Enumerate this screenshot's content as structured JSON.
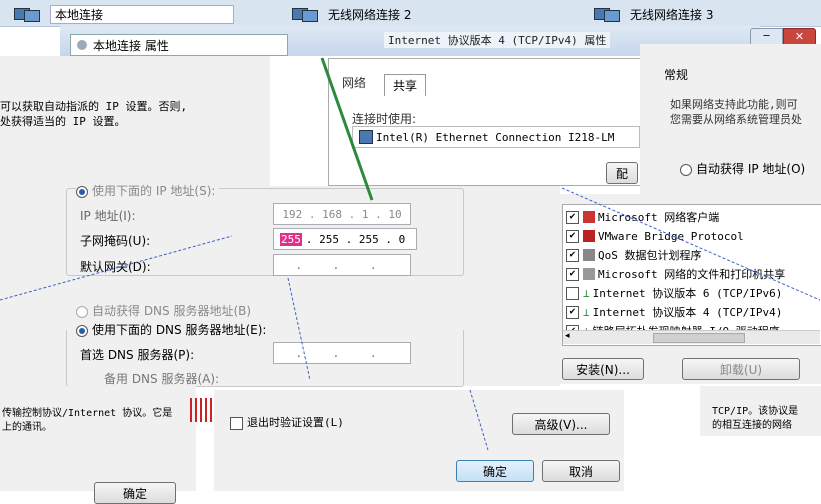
{
  "top_strip": {
    "items": [
      "本地连接",
      "无线网络连接 2",
      "无线网络连接 3"
    ],
    "dialog_title": "Internet 协议版本 4 (TCP/IPv4) 属性",
    "subtitle_left": "本地连接 属性"
  },
  "left_intro": {
    "line1": "可以获取自动指派的 IP 设置。否则,",
    "line2": "处获得适当的 IP 设置。"
  },
  "connection_dialog": {
    "tabs": [
      "网络",
      "共享"
    ],
    "connect_using_label": "连接时使用:",
    "adapter": "Intel(R) Ethernet Connection I218-LM",
    "configure_button": "配"
  },
  "alt_config": {
    "tab_label": "常规",
    "desc_line1": "如果网络支持此功能,则可",
    "desc_line2": "您需要从网络系统管理员处",
    "auto_ip_label": "自动获得 IP 地址(O)"
  },
  "ip_form": {
    "use_ip_label": "使用下面的 IP 地址(S):",
    "ip_label": "IP 地址(I):",
    "ip_value": "192 . 168 . 1 . 10",
    "subnet_label": "子网掩码(U):",
    "subnet_first": "255",
    "subnet_rest": ". 255 . 255 . 0",
    "gateway_label": "默认网关(D):",
    "gateway_value": ". . .",
    "auto_dns_label": "自动获得 DNS 服务器地址(B)",
    "manual_dns_label": "使用下面的 DNS 服务器地址(E):",
    "preferred_dns_label": "首选 DNS 服务器(P):",
    "preferred_dns_value": ". . .",
    "alternate_dns_label": "备用 DNS 服务器(A):"
  },
  "components": {
    "items": [
      {
        "label": "Microsoft 网络客户端",
        "checked": true
      },
      {
        "label": "VMware Bridge Protocol",
        "checked": true
      },
      {
        "label": "QoS 数据包计划程序",
        "checked": true
      },
      {
        "label": "Microsoft 网络的文件和打印机共享",
        "checked": true
      },
      {
        "label": "Internet 协议版本 6 (TCP/IPv6)",
        "checked": false
      },
      {
        "label": "Internet 协议版本 4 (TCP/IPv4)",
        "checked": true
      },
      {
        "label": "链路层拓扑发现映射器 I/O 驱动程序",
        "checked": true
      }
    ],
    "install_button": "安装(N)...",
    "uninstall_button": "卸载(U)"
  },
  "bottom": {
    "left_text1": "传输控制协议/Internet 协议。它是",
    "left_text2": "上的通讯。",
    "validate_label": "退出时验证设置(L)",
    "advanced_button": "高级(V)...",
    "ok_button": "确定",
    "cancel_button": "取消",
    "bottom_ok": "确定",
    "right_text1": "TCP/IP。该协议是",
    "right_text2": "的相互连接的网络"
  },
  "colors": {
    "strip": "#d9e4f1",
    "dialog_bg": "#f0f0f0",
    "highlight": "#e0308a",
    "arrow": "#4060c0",
    "green_line": "#2c8a3c"
  }
}
